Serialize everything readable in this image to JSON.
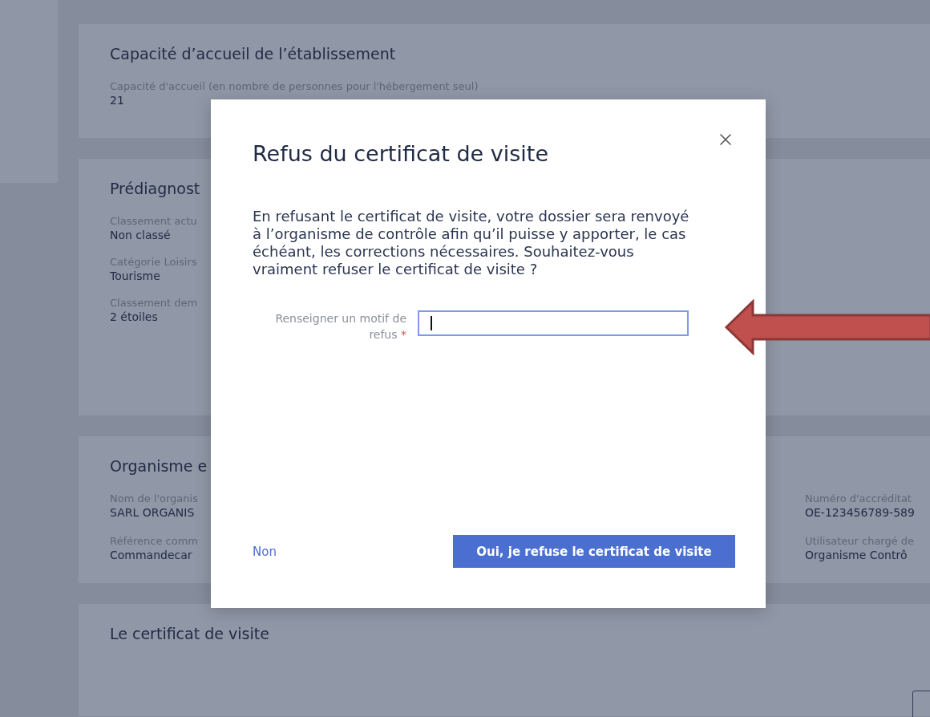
{
  "sections": [
    {
      "title": "Capacité d’accueil de l’établissement",
      "fields": [
        {
          "label": "Capacité d'accueil (en nombre de personnes pour l'hébergement seul)",
          "value": "21"
        }
      ]
    },
    {
      "title": "Prédiagnost",
      "fields": [
        {
          "label": "Classement actu",
          "value": "Non classé"
        },
        {
          "label": "Catégorie Loisirs",
          "value": "Tourisme"
        },
        {
          "label": "Classement dem",
          "value": "2 étoiles"
        }
      ]
    },
    {
      "title": "Organisme e",
      "fields": [
        {
          "label": "Nom de l'organis",
          "value": "SARL ORGANIS"
        },
        {
          "label": "Référence comm",
          "value": "Commandecar"
        }
      ],
      "side_fields": [
        {
          "label": "Numéro d'accréditat",
          "value": "OE-123456789-589"
        },
        {
          "label": "Utilisateur chargé de",
          "value": "Organisme Contrô"
        }
      ]
    },
    {
      "title": "Le certificat de visite",
      "partial_button": true
    }
  ],
  "modal": {
    "title": "Refus du certificat de visite",
    "message": "En refusant le certificat de visite, votre dossier sera renvoyé à l’organisme de contrôle afin qu’il puisse y apporter, le cas échéant, les corrections nécessaires. Souhaitez-vous vraiment refuser le certificat de visite ?",
    "field": {
      "label": "Renseigner un motif de refus",
      "required_mark": "*",
      "focused": true
    },
    "cancel": "Non",
    "confirm": "Oui, je refuse le certificat de visite"
  }
}
